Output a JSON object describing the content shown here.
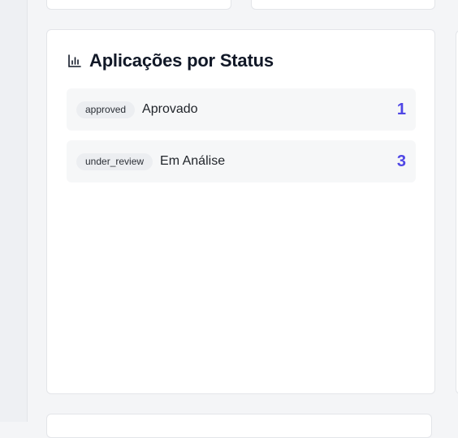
{
  "card": {
    "title": "Aplicações por Status",
    "icon": "bar-chart-icon"
  },
  "statuses": [
    {
      "tag": "approved",
      "label": "Aprovado",
      "count": "1"
    },
    {
      "tag": "under_review",
      "label": "Em Análise",
      "count": "3"
    }
  ],
  "colors": {
    "accent": "#4f46e5",
    "card_bg": "#ffffff",
    "row_bg": "#f6f7f8",
    "page_bg": "#f4f5f7"
  }
}
